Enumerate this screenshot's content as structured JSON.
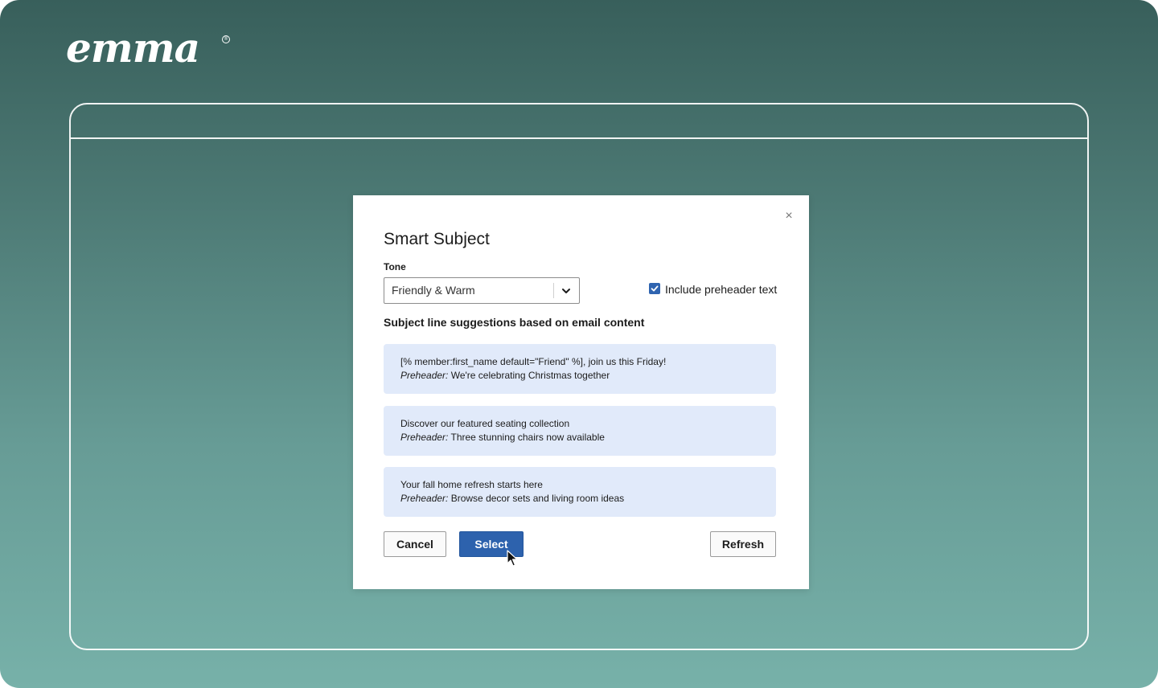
{
  "brand": {
    "logo_text": "emma",
    "registered_mark": "®"
  },
  "modal": {
    "close_glyph": "×",
    "title": "Smart Subject",
    "tone": {
      "label": "Tone",
      "selected": "Friendly & Warm"
    },
    "include_preheader": {
      "label": "Include preheader text",
      "checked": true
    },
    "suggestions_heading": "Subject line suggestions based on email content",
    "preheader_prefix": "Preheader:",
    "suggestions": [
      {
        "subject": "[% member:first_name default=\"Friend\" %], join us this Friday!",
        "preheader": "We're celebrating Christmas together"
      },
      {
        "subject": "Discover our featured seating collection",
        "preheader": "Three stunning chairs now available"
      },
      {
        "subject": "Your fall home refresh starts here",
        "preheader": "Browse decor sets and living room ideas"
      }
    ],
    "buttons": {
      "cancel": "Cancel",
      "select": "Select",
      "refresh": "Refresh"
    }
  },
  "colors": {
    "background_top": "#385f5b",
    "background_bottom": "#77b1a9",
    "primary_button": "#2d62ad",
    "suggestion_bg": "#e1eafa"
  }
}
